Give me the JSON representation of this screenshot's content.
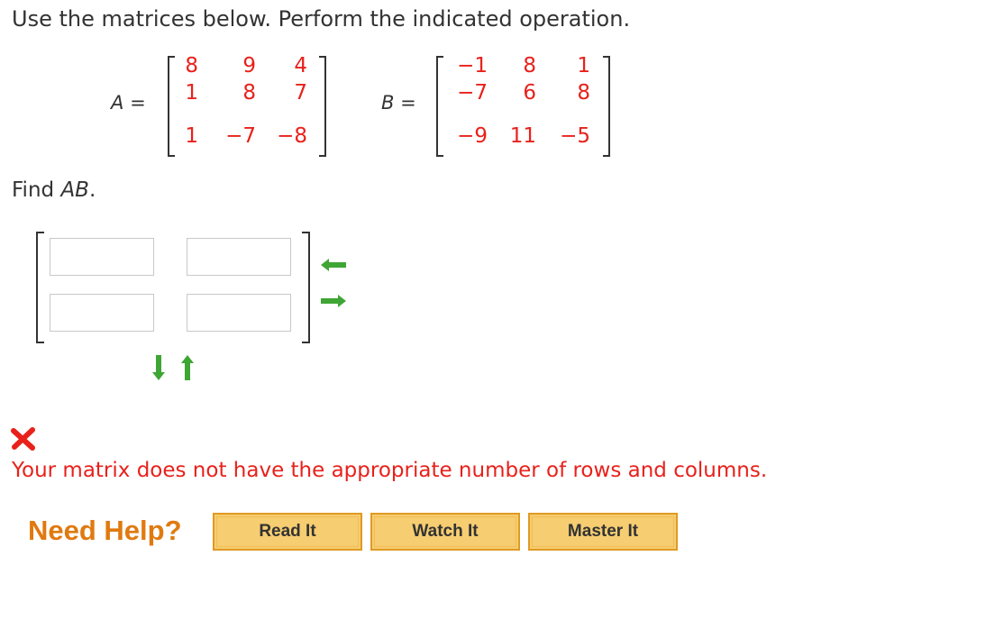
{
  "instruction": "Use the matrices below. Perform the indicated operation.",
  "matrix_a": {
    "label": "A",
    "equals": "=",
    "rows": [
      [
        "8",
        "9",
        "4"
      ],
      [
        "1",
        "8",
        "7"
      ],
      [
        "1",
        "−7",
        "−8"
      ]
    ]
  },
  "matrix_b": {
    "label": "B",
    "equals": "=",
    "rows": [
      [
        "−1",
        "8",
        "1"
      ],
      [
        "−7",
        "6",
        "8"
      ],
      [
        "−9",
        "11",
        "−5"
      ]
    ]
  },
  "task": {
    "prefix": "Find ",
    "operand": "AB",
    "suffix": "."
  },
  "answer_matrix": {
    "values": [
      "",
      "",
      "",
      ""
    ]
  },
  "controls": {
    "add_column_icon": "arrow-left-icon",
    "remove_column_icon": "arrow-right-icon",
    "remove_row_icon": "arrow-down-icon",
    "add_row_icon": "arrow-up-icon"
  },
  "feedback": {
    "status_icon": "red-x-icon",
    "message": "Your matrix does not have the appropriate number of rows and columns."
  },
  "help": {
    "label": "Need Help?",
    "buttons": [
      "Read It",
      "Watch It",
      "Master It"
    ]
  },
  "colors": {
    "matrix_values": "#e8211b",
    "error": "#e8211b",
    "arrow": "#3fa535",
    "help_text": "#e07a10",
    "button_fill": "#f6cd70"
  }
}
